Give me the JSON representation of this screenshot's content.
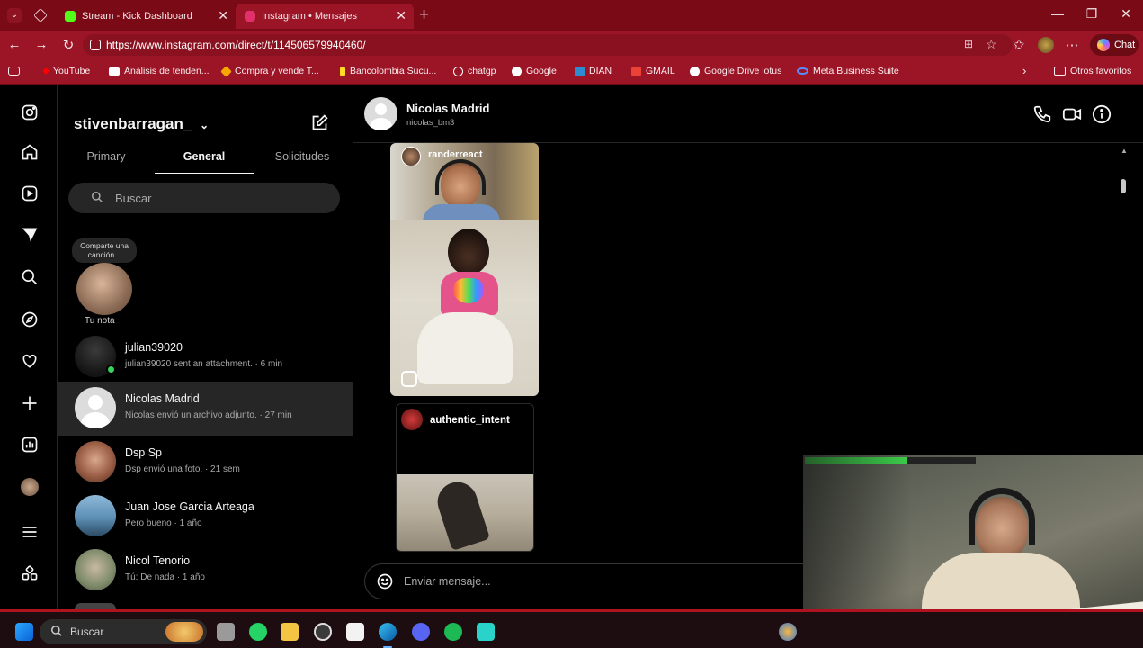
{
  "browser": {
    "tabs": [
      {
        "title": "Stream - Kick Dashboard",
        "favicon_color": "#53fc18"
      },
      {
        "title": "Instagram • Mensajes",
        "favicon_color": "#e1306c"
      }
    ],
    "url": "https://www.instagram.com/direct/t/114506579940460/",
    "chat_label": "Chat",
    "bookmarks": [
      {
        "label": "YouTube",
        "color": "#ff0000"
      },
      {
        "label": "Análisis de tenden...",
        "color": "#ffffff"
      },
      {
        "label": "Compra y vende T...",
        "color": "#f7a600"
      },
      {
        "label": "Bancolombia Sucu...",
        "color": "#fdda24"
      },
      {
        "label": "chatgp",
        "color": "#ffffff"
      },
      {
        "label": "Google",
        "color": "#ffffff"
      },
      {
        "label": "DIAN",
        "color": "#2e8bd0"
      },
      {
        "label": "GMAIL",
        "color": "#ea4335"
      },
      {
        "label": "Google Drive lotus",
        "color": "#ffffff"
      },
      {
        "label": "Meta Business Suite",
        "color": "#0866ff"
      }
    ],
    "other_bookmarks": "Otros favoritos"
  },
  "inbox": {
    "username": "stivenbarragan_",
    "tabs": [
      "Primary",
      "General",
      "Solicitudes"
    ],
    "active_tab": "General",
    "search_placeholder": "Buscar",
    "note": {
      "bubble": "Comparte una canción...",
      "label": "Tu nota"
    },
    "threads": [
      {
        "name": "julian39020",
        "preview": "julian39020 sent an attachment. · 6 min",
        "online": true,
        "selected": false
      },
      {
        "name": "Nicolas Madrid",
        "preview": "Nicolas envió un archivo adjunto. · 27 min",
        "online": false,
        "selected": true
      },
      {
        "name": "Dsp Sp",
        "preview": "Dsp envió una foto. · 21 sem",
        "online": false,
        "selected": false
      },
      {
        "name": "Juan Jose Garcia Arteaga",
        "preview": "Pero bueno · 1 año",
        "online": false,
        "selected": false
      },
      {
        "name": "Nicol Tenorio",
        "preview": "Tú: De nada · 1 año",
        "online": false,
        "selected": false
      }
    ]
  },
  "conversation": {
    "name": "Nicolas Madrid",
    "username": "nicolas_bm3",
    "messages": [
      {
        "type": "reel",
        "author": "randerreact"
      },
      {
        "type": "reel",
        "author": "authentic_intent"
      }
    ],
    "input_placeholder": "Enviar mensaje..."
  },
  "taskbar": {
    "search_label": "Buscar"
  },
  "colors": {
    "accent": "#9b1526",
    "ig_bg": "#000000",
    "selected": "#262626"
  }
}
